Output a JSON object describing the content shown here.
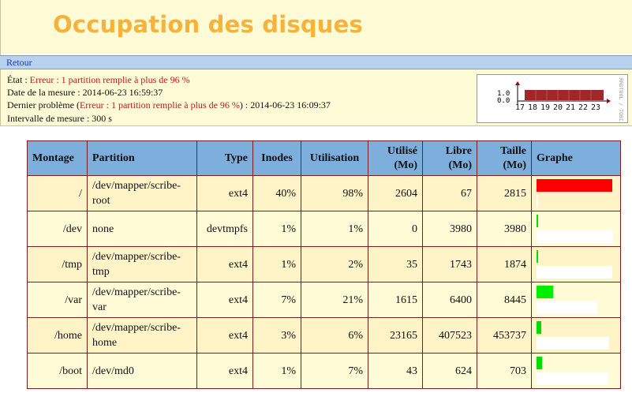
{
  "header": {
    "title": "Occupation des disques"
  },
  "nav": {
    "back_label": "Retour"
  },
  "status": {
    "state_label": "État : ",
    "state_value": "Erreur : 1 partition remplie à plus de 96 %",
    "date_label": "Date de la mesure : ",
    "date_value": "2014-06-23 16:59:37",
    "last_problem_label": "Dernier problème (",
    "last_problem_error": "Erreur : 1 partition remplie à plus de 96 %",
    "last_problem_sep": ") : ",
    "last_problem_date": "2014-06-23 16:09:37",
    "interval_label": "Intervalle de mesure : ",
    "interval_value": "300 s"
  },
  "sparkline": {
    "y_ticks": [
      "1.0",
      "0.0"
    ],
    "x_ticks": [
      "17",
      "18",
      "19",
      "20",
      "21",
      "22",
      "23"
    ],
    "watermark": "RRDTOOL / TOBI OETIKER"
  },
  "table": {
    "headers": {
      "mount": "Montage",
      "partition": "Partition",
      "type": "Type",
      "inodes": "Inodes",
      "usage": "Utilisation",
      "used_1": "Utilisé",
      "used_2": "(Mo)",
      "free_1": "Libre",
      "free_2": "(Mo)",
      "size_1": "Taille",
      "size_2": "(Mo)",
      "graph": "Graphe"
    },
    "rows": [
      {
        "mount": "/",
        "partition_1": "/dev/mapper/scribe-",
        "partition_2": "root",
        "type": "ext4",
        "inodes": "40%",
        "usage": "98%",
        "used": "2604",
        "free": "67",
        "size": "2815",
        "usage_fraction": 0.98,
        "bar_color": "#ff0000"
      },
      {
        "mount": "/dev",
        "partition_1": "none",
        "partition_2": "",
        "type": "devtmpfs",
        "inodes": "1%",
        "usage": "1%",
        "used": "0",
        "free": "3980",
        "size": "3980",
        "usage_fraction": 0.01,
        "bar_color": "#00dd00"
      },
      {
        "mount": "/tmp",
        "partition_1": "/dev/mapper/scribe-",
        "partition_2": "tmp",
        "type": "ext4",
        "inodes": "1%",
        "usage": "2%",
        "used": "35",
        "free": "1743",
        "size": "1874",
        "usage_fraction": 0.02,
        "bar_color": "#00dd00"
      },
      {
        "mount": "/var",
        "partition_1": "/dev/mapper/scribe-",
        "partition_2": "var",
        "type": "ext4",
        "inodes": "7%",
        "usage": "21%",
        "used": "1615",
        "free": "6400",
        "size": "8445",
        "usage_fraction": 0.21,
        "bar_color": "#00ee00"
      },
      {
        "mount": "/home",
        "partition_1": "/dev/mapper/scribe-",
        "partition_2": "home",
        "type": "ext4",
        "inodes": "3%",
        "usage": "6%",
        "used": "23165",
        "free": "407523",
        "size": "453737",
        "usage_fraction": 0.06,
        "bar_color": "#00dd00"
      },
      {
        "mount": "/boot",
        "partition_1": "/dev/md0",
        "partition_2": "",
        "type": "ext4",
        "inodes": "1%",
        "usage": "7%",
        "used": "43",
        "free": "624",
        "size": "703",
        "usage_fraction": 0.07,
        "bar_color": "#00dd00"
      }
    ]
  }
}
